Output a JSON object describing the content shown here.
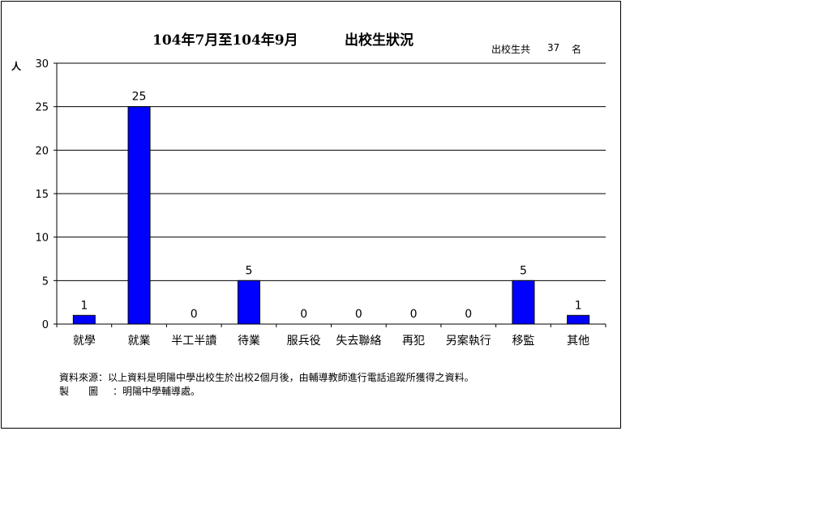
{
  "title": {
    "range": "104年7月至104年9月",
    "main": "出校生狀況"
  },
  "total": {
    "label": "出校生共",
    "count": "37",
    "unit": "名"
  },
  "notes": {
    "source": "資料來源：以上資料是明陽中學出校生於出校2個月後，由輔導教師進行電話追蹤所獲得之資料。",
    "maker_key": "製　　圖",
    "maker_value": "：明陽中學輔導處。"
  },
  "colors": {
    "bar": "#0000ff",
    "grid": "#000000"
  },
  "chart_data": {
    "type": "bar",
    "title": "104年7月至104年9月　出校生狀況",
    "xlabel": "",
    "ylabel": "人",
    "ylim": [
      0,
      30
    ],
    "yticks": [
      0,
      5,
      10,
      15,
      20,
      25,
      30
    ],
    "grid": true,
    "legend": "none",
    "categories": [
      "就學",
      "就業",
      "半工半讀",
      "待業",
      "服兵役",
      "失去聯絡",
      "再犯",
      "另案執行",
      "移監",
      "其他"
    ],
    "values": [
      1,
      25,
      0,
      5,
      0,
      0,
      0,
      0,
      5,
      1
    ]
  }
}
